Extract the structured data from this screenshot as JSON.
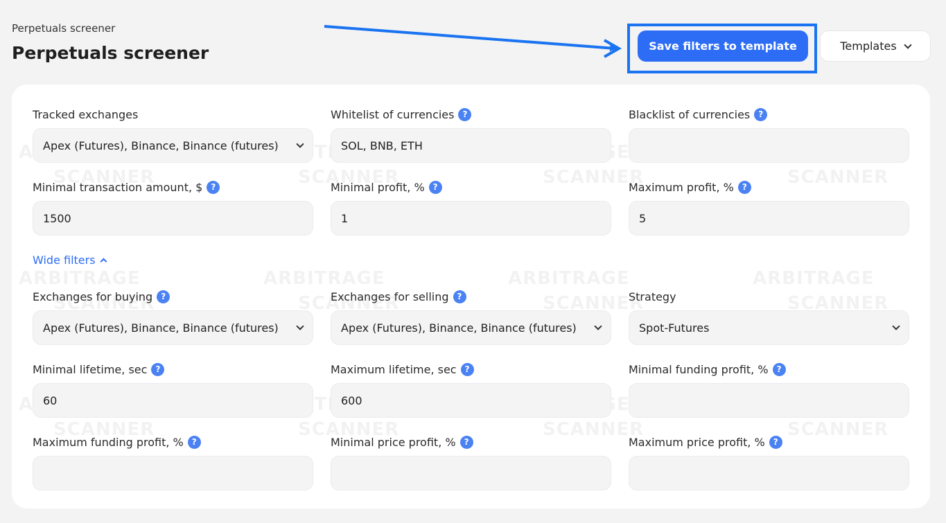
{
  "header": {
    "breadcrumb": "Perpetuals screener",
    "title": "Perpetuals screener",
    "save_label": "Save filters to template",
    "templates_label": "Templates"
  },
  "watermark": {
    "line1": "ARBITRAGE",
    "line2": "SCANNER"
  },
  "colors": {
    "accent": "#2d6df6",
    "highlight": "#1a73f0"
  },
  "wide_filters_label": "Wide filters",
  "fields": {
    "tracked_exchanges": {
      "label": "Tracked exchanges",
      "value": "Apex (Futures), Binance, Binance (futures)"
    },
    "whitelist": {
      "label": "Whitelist of currencies",
      "value": "SOL, BNB, ETH"
    },
    "blacklist": {
      "label": "Blacklist of currencies",
      "value": ""
    },
    "min_amount": {
      "label": "Minimal transaction amount, $",
      "value": "1500"
    },
    "min_profit": {
      "label": "Minimal profit, %",
      "value": "1"
    },
    "max_profit": {
      "label": "Maximum profit, %",
      "value": "5"
    },
    "buy_exchanges": {
      "label": "Exchanges for buying",
      "value": "Apex (Futures), Binance, Binance (futures)"
    },
    "sell_exchanges": {
      "label": "Exchanges for selling",
      "value": "Apex (Futures), Binance, Binance (futures)"
    },
    "strategy": {
      "label": "Strategy",
      "value": "Spot-Futures"
    },
    "min_lifetime": {
      "label": "Minimal lifetime, sec",
      "value": "60"
    },
    "max_lifetime": {
      "label": "Maximum lifetime, sec",
      "value": "600"
    },
    "min_funding": {
      "label": "Minimal funding profit, %",
      "value": ""
    },
    "max_funding": {
      "label": "Maximum funding profit, %",
      "value": ""
    },
    "min_price": {
      "label": "Minimal price profit, %",
      "value": ""
    },
    "max_price": {
      "label": "Maximum price profit, %",
      "value": ""
    }
  }
}
